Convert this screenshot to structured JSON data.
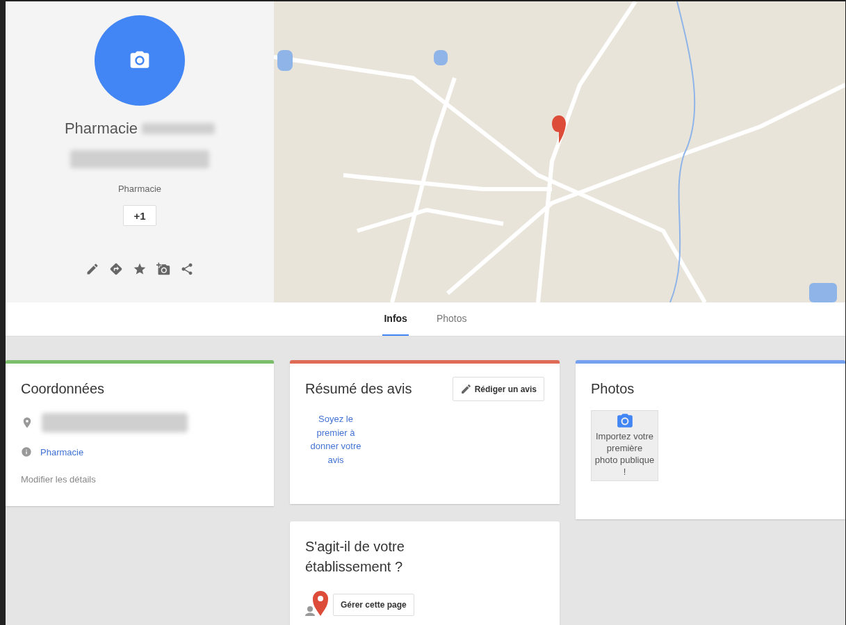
{
  "profile": {
    "name": "Pharmacie",
    "category": "Pharmacie",
    "plus_one": "+1"
  },
  "tabs": [
    {
      "label": "Infos",
      "selected": true
    },
    {
      "label": "Photos",
      "selected": false
    }
  ],
  "contact_card": {
    "title": "Coordonnées",
    "color": "#7cbf6a",
    "category_link": "Pharmacie",
    "edit_link": "Modifier les détails"
  },
  "reviews_card": {
    "title": "Résumé des avis",
    "color": "#dd6b55",
    "write_button": "Rédiger un avis",
    "prompt": "Soyez le premier à donner votre avis"
  },
  "photos_card": {
    "title": "Photos",
    "color": "#76a1f0",
    "upload_text": "Importez votre première photo publique !"
  },
  "claim_card": {
    "title": "S'agit-il de votre établissement ?",
    "manage_button": "Gérer cette page"
  }
}
